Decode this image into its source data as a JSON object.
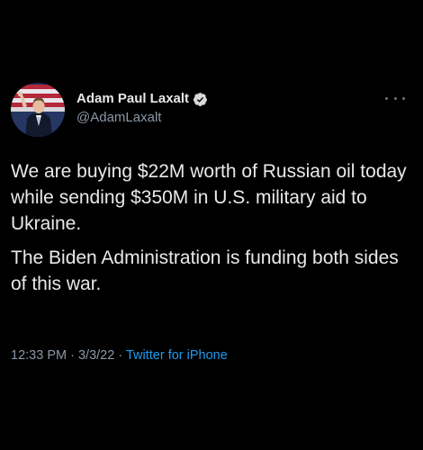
{
  "tweet": {
    "author": {
      "display_name": "Adam Paul Laxalt",
      "handle": "@AdamLaxalt",
      "verified": true,
      "verified_icon": "verified-badge-icon",
      "avatar_icon": "avatar"
    },
    "more_icon": "more-options-icon",
    "paragraphs": [
      "We are buying $22M worth of Russian oil today while sending $350M in U.S. military aid to Ukraine.",
      "The Biden Administration is funding both sides of this war."
    ],
    "time": "12:33 PM",
    "date": "3/3/22",
    "separator": "·",
    "source": "Twitter for iPhone"
  },
  "colors": {
    "background": "#000000",
    "text": "#e9e9e9",
    "secondary_text": "#8b98a5",
    "link": "#1d9bf0",
    "verified_badge": "#d9d9d9"
  }
}
